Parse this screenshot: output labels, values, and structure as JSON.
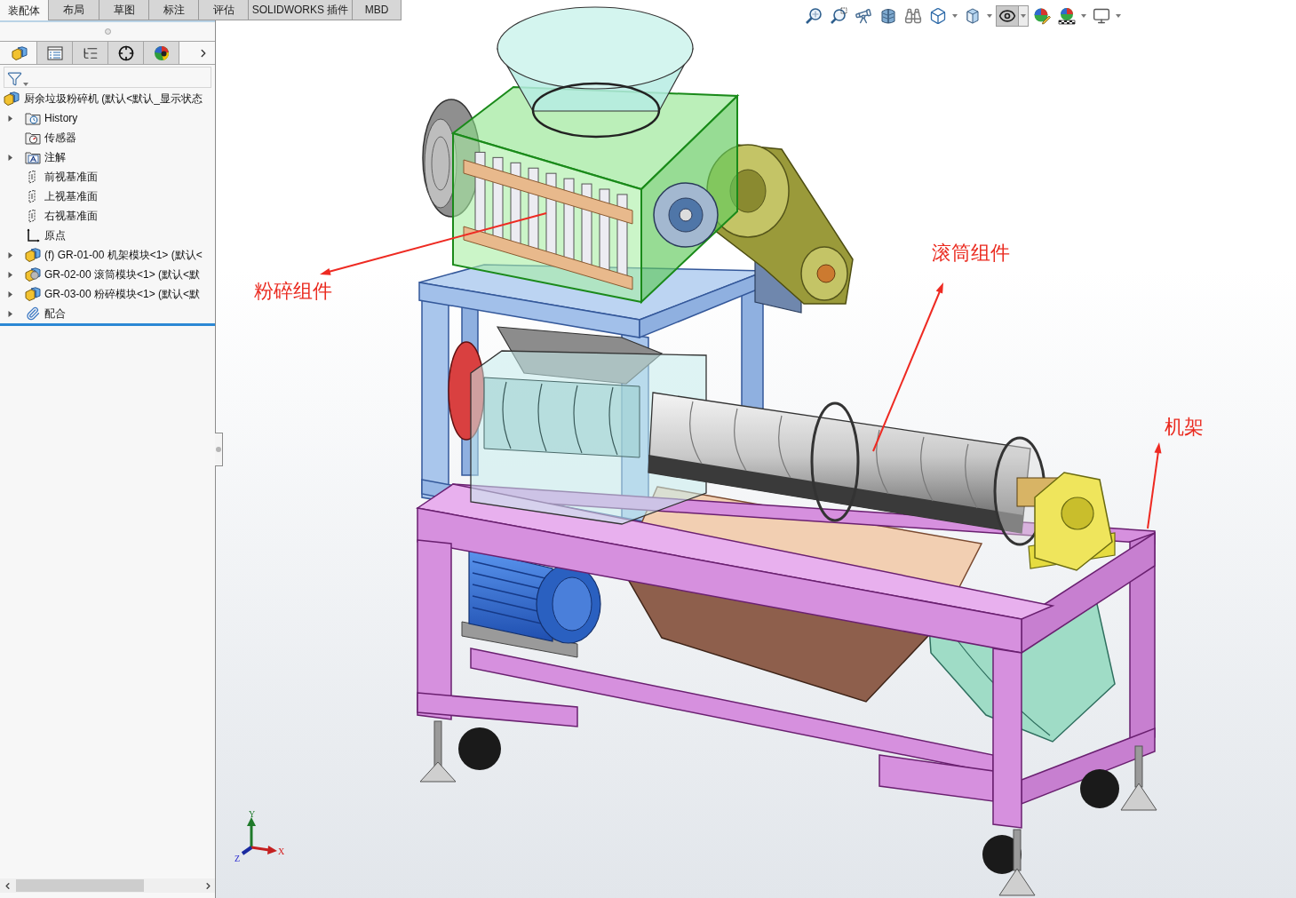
{
  "command_tabs": [
    {
      "label": "装配体",
      "selected": true
    },
    {
      "label": "布局",
      "selected": false
    },
    {
      "label": "草图",
      "selected": false
    },
    {
      "label": "标注",
      "selected": false
    },
    {
      "label": "评估",
      "selected": false
    },
    {
      "label": "SOLIDWORKS 插件",
      "selected": false
    },
    {
      "label": "MBD",
      "selected": false
    }
  ],
  "panel_tabs": [
    {
      "selected": true
    },
    {
      "selected": false
    },
    {
      "selected": false
    },
    {
      "selected": false
    },
    {
      "selected": false
    }
  ],
  "feature_tree": {
    "label": "厨余垃圾粉碎机 (默认<默认_显示状态",
    "kind": "assembly",
    "children": [
      {
        "label": "History",
        "kind": "history",
        "expanded": false
      },
      {
        "label": "传感器",
        "kind": "sensors"
      },
      {
        "label": "注解",
        "kind": "annotations",
        "expanded": false
      },
      {
        "label": "前视基准面",
        "kind": "plane"
      },
      {
        "label": "上视基准面",
        "kind": "plane"
      },
      {
        "label": "右视基准面",
        "kind": "plane"
      },
      {
        "label": "原点",
        "kind": "origin"
      },
      {
        "label": "(f) GR-01-00 机架模块<1> (默认<",
        "kind": "subassembly",
        "expanded": false
      },
      {
        "label": "GR-02-00 滚筒模块<1> (默认<默",
        "kind": "subassembly-light",
        "expanded": false
      },
      {
        "label": "GR-03-00 粉碎模块<1> (默认<默",
        "kind": "subassembly",
        "expanded": false
      },
      {
        "label": "配合",
        "kind": "mates",
        "expanded": false
      }
    ]
  },
  "view_toolbar": [
    {
      "pressed": false,
      "menu": false
    },
    {
      "pressed": false,
      "menu": false
    },
    {
      "pressed": false,
      "menu": false
    },
    {
      "pressed": false,
      "menu": false
    },
    {
      "pressed": false,
      "menu": false
    },
    {
      "pressed": false,
      "menu": true
    },
    {
      "pressed": false,
      "menu": true
    },
    {
      "pressed": true,
      "menu": true
    },
    {
      "pressed": false,
      "menu": false
    },
    {
      "pressed": false,
      "menu": true
    },
    {
      "pressed": false,
      "menu": true
    }
  ],
  "annotations": [
    {
      "label": "粉碎组件"
    },
    {
      "label": "滚筒组件"
    },
    {
      "label": "机架"
    }
  ],
  "triad": {
    "x": "X",
    "y": "Y",
    "z": "Z"
  }
}
